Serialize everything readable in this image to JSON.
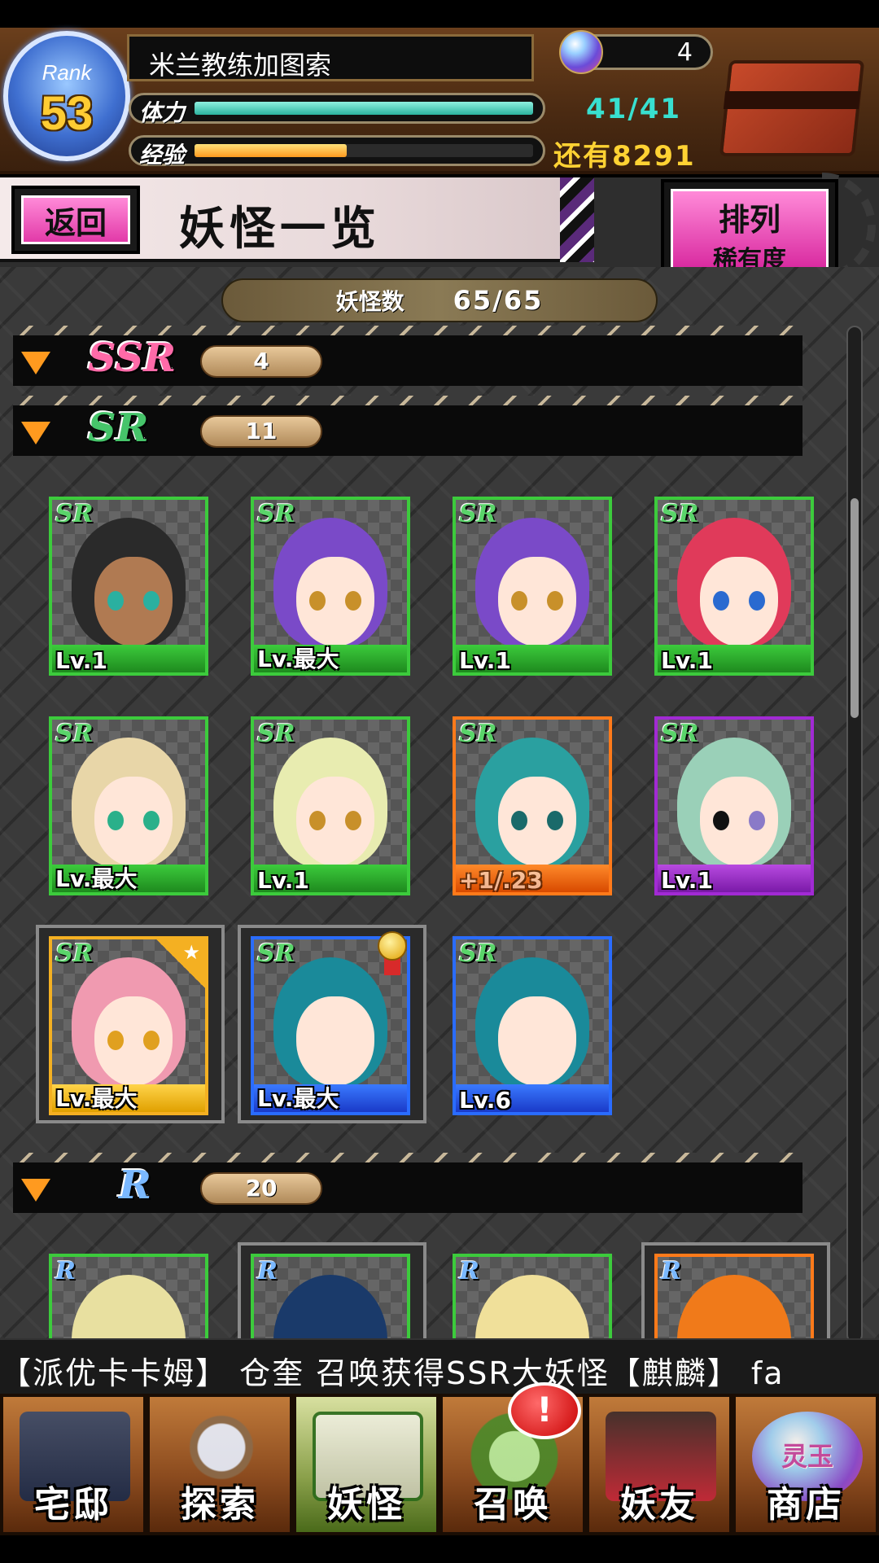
{
  "header": {
    "rank_label": "Rank",
    "rank_value": "53",
    "player_name": "米兰教练加图索",
    "gem_count": "4",
    "stamina_label": "体力",
    "stamina_value": "41/41",
    "stamina_fraction": 1.0,
    "exp_label": "经验",
    "exp_fraction": 0.45,
    "exp_remaining": "还有8291",
    "chest_icon": "treasure-chest-icon"
  },
  "subheader": {
    "back_label": "返回",
    "title": "妖怪一览",
    "sort_title": "排列",
    "sort_sub": "稀有度"
  },
  "list": {
    "count_label": "妖怪数",
    "count_value": "65/65",
    "groups": [
      {
        "rarity": "SSR",
        "count": "4"
      },
      {
        "rarity": "SR",
        "count": "11"
      },
      {
        "rarity": "R",
        "count": "20"
      }
    ],
    "sr_cards": [
      {
        "tag": "SR",
        "level": "Lv.1",
        "frame": "green"
      },
      {
        "tag": "SR",
        "level": "Lv.最大",
        "frame": "green"
      },
      {
        "tag": "SR",
        "level": "Lv.1",
        "frame": "green"
      },
      {
        "tag": "SR",
        "level": "Lv.1",
        "frame": "green"
      },
      {
        "tag": "SR",
        "level": "Lv.最大",
        "frame": "green"
      },
      {
        "tag": "SR",
        "level": "Lv.1",
        "frame": "green"
      },
      {
        "tag": "SR",
        "level": "+1/.23",
        "frame": "orange"
      },
      {
        "tag": "SR",
        "level": "Lv.1",
        "frame": "purple"
      },
      {
        "tag": "SR",
        "level": "Lv.最大",
        "frame": "gold"
      },
      {
        "tag": "SR",
        "level": "Lv.最大",
        "frame": "blue"
      },
      {
        "tag": "SR",
        "level": "Lv.6",
        "frame": "blue"
      }
    ],
    "r_cards": [
      {
        "tag": "R",
        "frame": "green"
      },
      {
        "tag": "R",
        "frame": "green"
      },
      {
        "tag": "R",
        "frame": "green"
      },
      {
        "tag": "R",
        "frame": "orange"
      }
    ]
  },
  "ticker": {
    "text": "【派优卡卡姆】  仓奎 召唤获得SSR大妖怪【麒麟】  fa"
  },
  "nav": {
    "items": [
      {
        "label": "宅邸",
        "icon": "mansion-icon"
      },
      {
        "label": "探索",
        "icon": "magnifier-icon"
      },
      {
        "label": "妖怪",
        "icon": "scroll-icon"
      },
      {
        "label": "召唤",
        "icon": "pentagram-icon"
      },
      {
        "label": "妖友",
        "icon": "catgirl-icon"
      },
      {
        "label": "商店",
        "icon": "orb-icon"
      }
    ],
    "alert": "!",
    "orb_text": "灵玉"
  },
  "colors": {
    "accent_pink": "#e23aa8",
    "sr_green": "#3ccb3c",
    "stamina_teal": "#38e0d0",
    "exp_gold": "#ffd233"
  }
}
